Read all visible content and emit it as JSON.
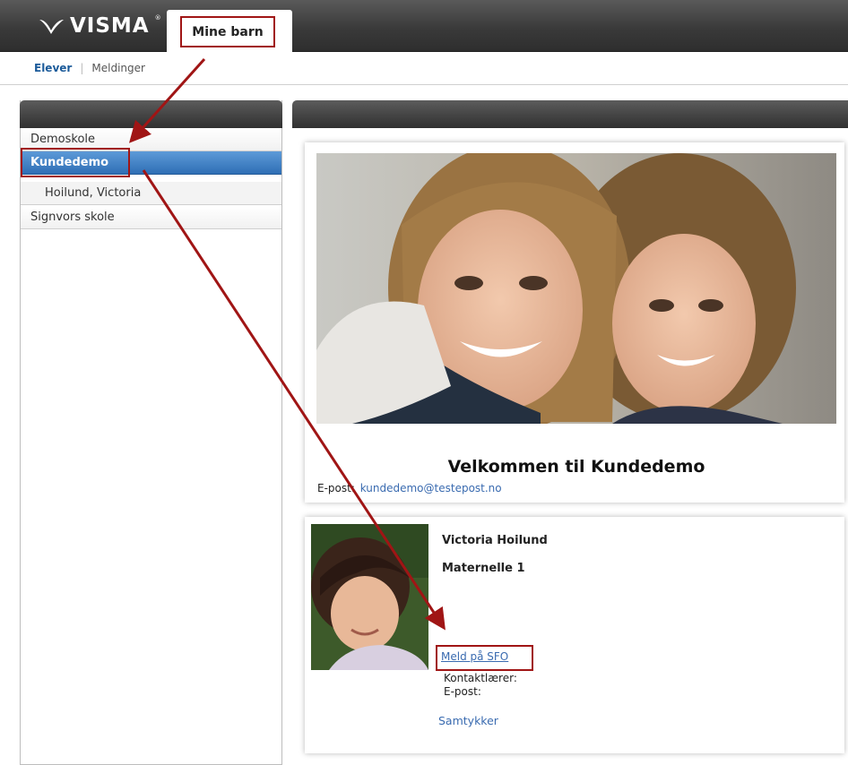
{
  "header": {
    "logo_text": "VISMA",
    "logo_reg": "®",
    "active_tab": "Mine barn"
  },
  "subnav": {
    "items": [
      {
        "label": "Elever",
        "active": true
      },
      {
        "label": "Meldinger",
        "active": false
      }
    ]
  },
  "sidebar": {
    "items": [
      {
        "label": "Demoskole",
        "type": "school"
      },
      {
        "label": "Kundedemo",
        "type": "school",
        "selected": true
      },
      {
        "label": "Hoilund, Victoria",
        "type": "child"
      },
      {
        "label": "Signvors skole",
        "type": "school"
      }
    ]
  },
  "school_card": {
    "welcome": "Velkommen til Kundedemo",
    "email_label": "E-post:",
    "email": "kundedemo@testepost.no"
  },
  "student_card": {
    "name": "Victoria Hoilund",
    "class": "Maternelle 1",
    "sfo_link": "Meld på SFO",
    "contact_teacher_label": "Kontaktlærer:",
    "email_label": "E-post:",
    "consent_link": "Samtykker"
  },
  "colors": {
    "accent": "#2f6fb5",
    "link": "#3a6bb0",
    "highlight": "#a01515",
    "header_dark": "#3a3a3a"
  }
}
